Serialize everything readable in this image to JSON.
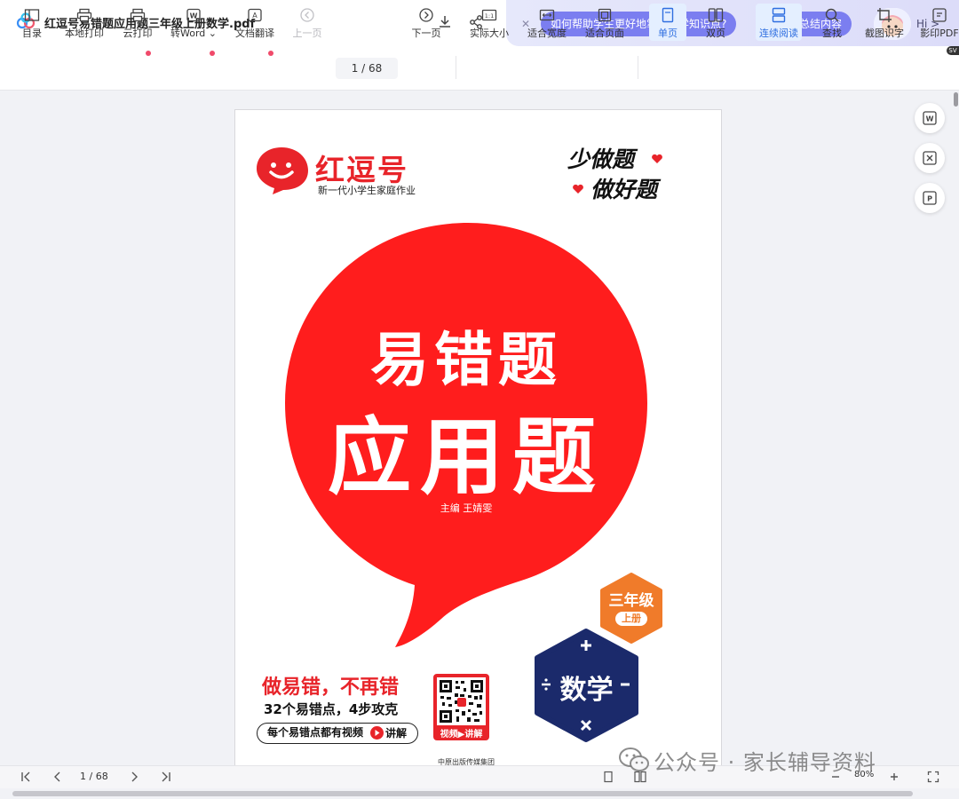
{
  "titlebar": {
    "doc_title": "红逗号易错题应用题三年级上册数学.pdf"
  },
  "ai_bar": {
    "chip1": "如何帮助学生更好地掌握数学知识点?",
    "chip2": "截图后总结内容",
    "hi": "Hi >"
  },
  "toolbar": {
    "items": [
      {
        "label": "目录"
      },
      {
        "label": "本地打印"
      },
      {
        "label": "云打印"
      },
      {
        "label": "转Word ⌄"
      },
      {
        "label": "文档翻译"
      },
      {
        "label": "上一页"
      },
      {
        "label": "下一页"
      },
      {
        "label": "实际大小"
      },
      {
        "label": "适合宽度"
      },
      {
        "label": "适合页面"
      },
      {
        "label": "单页"
      },
      {
        "label": "双页"
      },
      {
        "label": "连续阅读"
      },
      {
        "label": "查找"
      },
      {
        "label": "截图识字"
      },
      {
        "label": "影印PDF"
      }
    ],
    "page_indicator": "1 / 68",
    "badge": "SV"
  },
  "cover": {
    "brand": "红逗号",
    "brand_slogan": "新一代小学生家庭作业",
    "slogan1": "少做题",
    "slogan2": "做好题",
    "title1": "易错题",
    "title2": "应用题",
    "editor": "主编    王婧雯",
    "grade": "三年级",
    "grade_sub": "上册",
    "subject": "数学",
    "promo_headline": "做易错，不再错",
    "promo_sub": "32个易错点，4步攻克",
    "promo_pill": "每个易错点都有视频",
    "promo_pill_end": "讲解",
    "qr_label": "视频▶讲解",
    "publisher": "中原出版传媒集团"
  },
  "statusbar": {
    "page": "1 / 68",
    "zoom": "80%"
  },
  "watermark": "公众号 · 家长辅导资料",
  "colors": {
    "brand_red": "#e8242a",
    "accent_blue": "#2f6fe0",
    "ai_purple": "#7b7ef0",
    "grade_orange": "#f07b2a",
    "math_navy": "#1b2a6b"
  }
}
